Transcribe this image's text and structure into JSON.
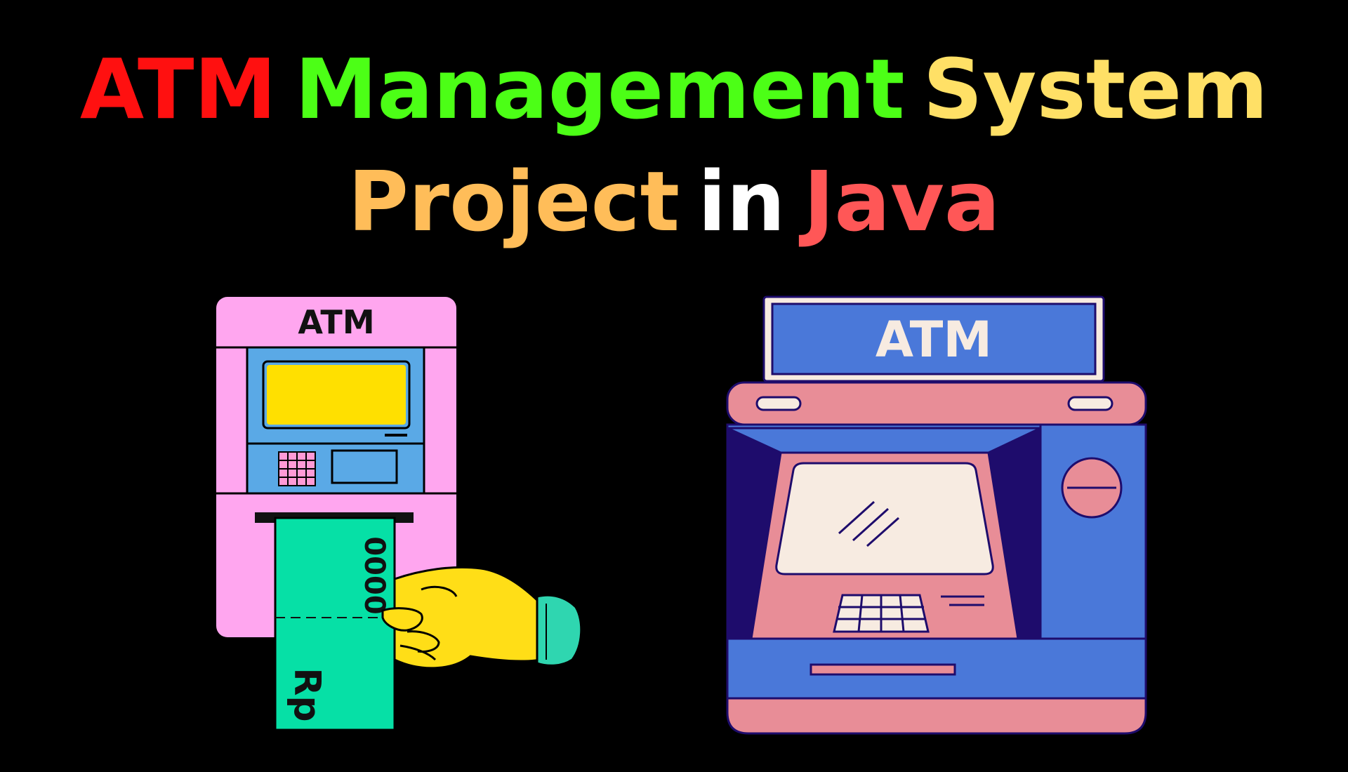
{
  "title": {
    "line1": [
      {
        "text": "ATM",
        "color": "#ff1010"
      },
      {
        "text": "Management",
        "color": "#4cff16"
      },
      {
        "text": "System",
        "color": "#ffe066"
      }
    ],
    "line2": [
      {
        "text": "Project",
        "color": "#ffbd59"
      },
      {
        "text": "in",
        "color": "#ffffff"
      },
      {
        "text": "Java",
        "color": "#ff5757"
      }
    ]
  },
  "left_atm": {
    "sign": "ATM",
    "banknote_digits": "0000",
    "banknote_currency": "Rp",
    "colors": {
      "body": "#ffa6ef",
      "panel": "#5aa9e6",
      "screen": "#ffe000",
      "banknote": "#06e0a6",
      "hand": "#ffde17",
      "cuff": "#2fd6b0"
    }
  },
  "right_atm": {
    "sign": "ATM",
    "colors": {
      "sign_bg": "#4a78d9",
      "body": "#4a78d9",
      "trim": "#e88d97",
      "dark": "#1e0c6c",
      "screen": "#f7ebe1"
    }
  }
}
